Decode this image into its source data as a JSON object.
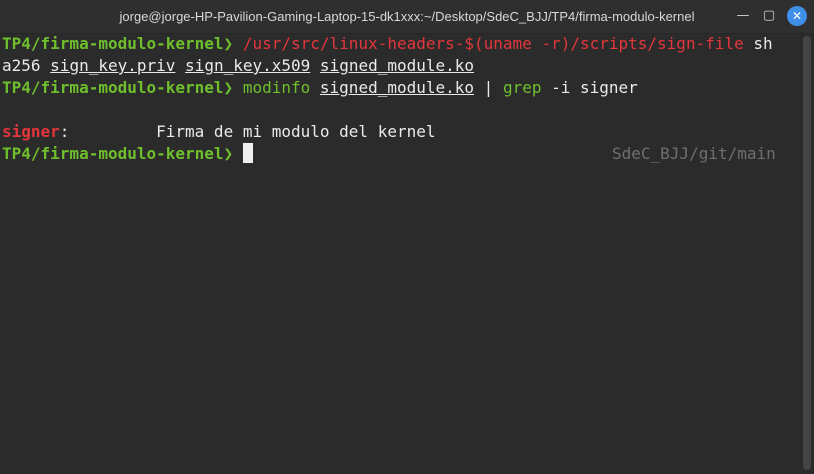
{
  "window": {
    "title": "jorge@jorge-HP-Pavilion-Gaming-Laptop-15-dk1xxx:~/Desktop/SdeC_BJJ/TP4/firma-modulo-kernel",
    "minimize_glyph": "—",
    "maximize_glyph": "▢",
    "close_glyph": "✕"
  },
  "terminal": {
    "prompt": "TP4/firma-modulo-kernel❯ ",
    "line1_cmd": "/usr/src/linux-headers-$(uname -r)/scripts/sign-file",
    "line1_arg": " sh",
    "line2_arg1": "a256 ",
    "line2_arg2": "sign_key.priv",
    "line2_sep1": " ",
    "line2_arg3": "sign_key.x509",
    "line2_sep2": " ",
    "line2_arg4": "signed_module.ko",
    "line3_cmd": "modinfo",
    "line3_sep": " ",
    "line3_file": "signed_module.ko",
    "line3_pipe": " | ",
    "line3_grep": "grep",
    "line3_args": " -i signer",
    "output_key": "signer",
    "output_colon": ":",
    "output_value": "         Firma de mi modulo del kernel",
    "right_prompt": "SdeC_BJJ/git/main"
  },
  "colors": {
    "background": "#2b2b2b",
    "prompt_green": "#6fbf2d",
    "error_red": "#e3363c",
    "close_button_blue": "#3f8ee8"
  }
}
